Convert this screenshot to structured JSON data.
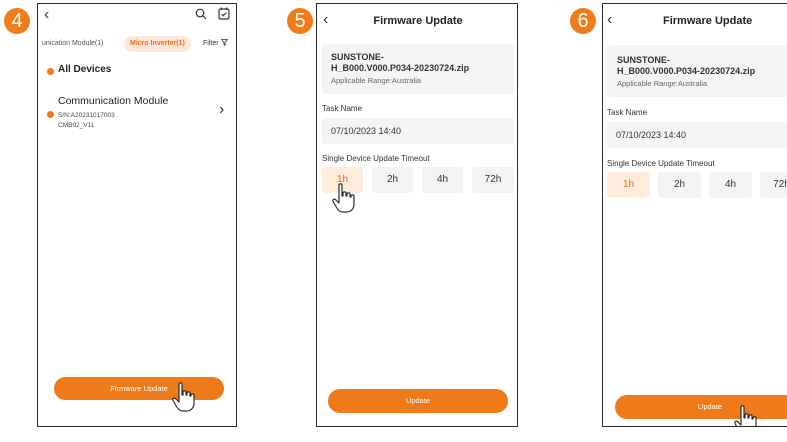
{
  "steps": [
    "4",
    "5",
    "6"
  ],
  "screen4": {
    "tab_communication": "unication Module(1)",
    "tab_micro_inverter": "Micro Inverter(1)",
    "filter_label": "Filter",
    "all_devices": "All Devices",
    "device": {
      "name": "Communication Module",
      "sn": "S/N:A20231017003",
      "model": "CMB02_V11"
    },
    "firmware_update_button": "Firmware Update"
  },
  "screen5": {
    "title": "Firmware Update",
    "file_name_line1": "SUNSTONE-",
    "file_name_line2": "H_B000.V000.P034-20230724.zip",
    "applicable_range": "Applicable Range:Australia",
    "task_name_label": "Task Name",
    "task_name_value": "07/10/2023 14:40",
    "timeout_label": "Single Device Update Timeout",
    "timeout_options": [
      "1h",
      "2h",
      "4h",
      "72h"
    ],
    "selected_timeout": "1h",
    "update_button": "Update"
  },
  "screen6": {
    "title": "Firmware Update",
    "file_name_line1": "SUNSTONE-",
    "file_name_line2": "H_B000.V000.P034-20230724.zip",
    "applicable_range": "Applicable Range:Australia",
    "task_name_label": "Task Name",
    "task_name_value": "07/10/2023 14:40",
    "timeout_label": "Single Device Update Timeout",
    "timeout_options": [
      "1h",
      "2h",
      "4h",
      "72h"
    ],
    "selected_timeout": "1h",
    "update_button": "Update"
  },
  "colors": {
    "accent": "#ef7a1a",
    "accent_light": "#fde7d8",
    "card_bg": "#f4f4f4"
  },
  "icons": [
    "back-arrow-icon",
    "search-icon",
    "calendar-icon",
    "filter-icon",
    "chevron-right-icon",
    "hand-pointer-icon"
  ]
}
